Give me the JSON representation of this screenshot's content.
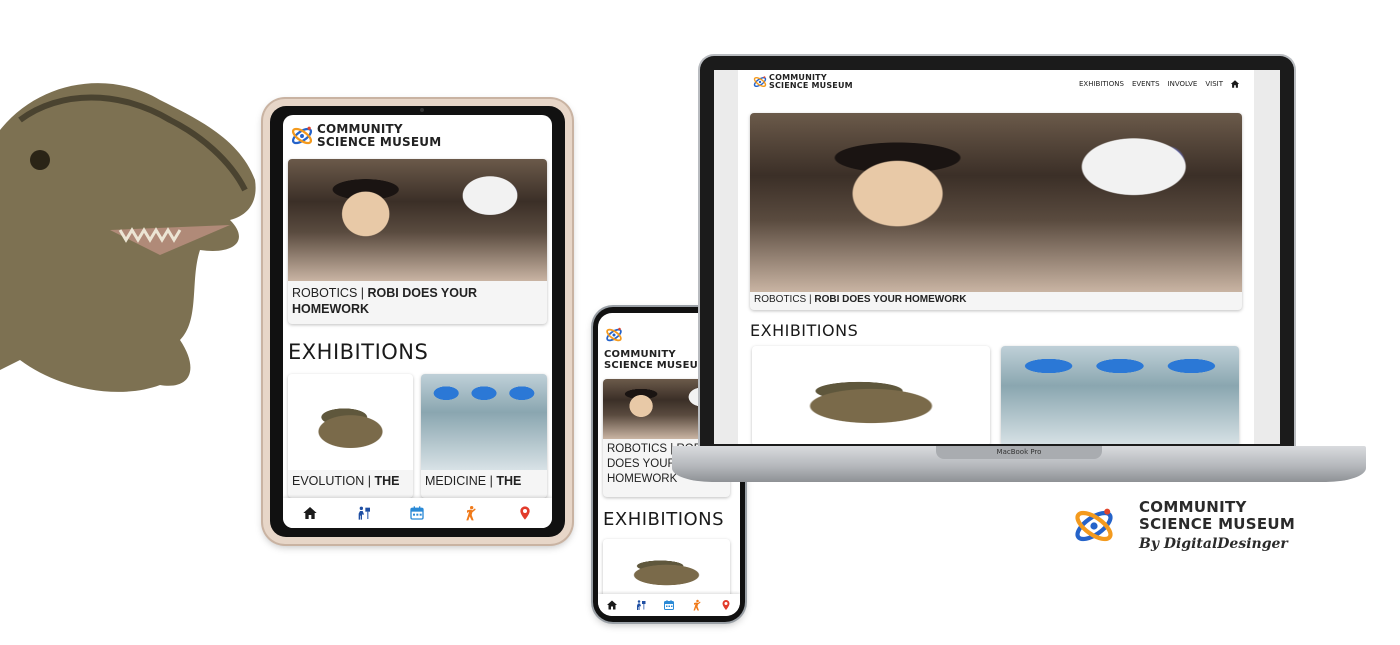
{
  "brand": {
    "name_line1": "COMMUNITY",
    "name_line2": "SCIENCE MUSEUM",
    "byline": "By DigitalDesinger",
    "colors": {
      "blue": "#2563c9",
      "orange": "#f39a1e",
      "red": "#e2452b"
    }
  },
  "feature": {
    "category": "ROBOTICS",
    "separator": "|",
    "title": "ROBI DOES YOUR HOMEWORK"
  },
  "section": {
    "heading": "EXHIBITIONS"
  },
  "exhibitions": [
    {
      "category": "EVOLUTION",
      "separator": "|",
      "title": "THE"
    },
    {
      "category": "MEDICINE",
      "separator": "|",
      "title": "THE"
    }
  ],
  "laptop": {
    "nav": [
      "EXHIBITIONS",
      "EVENTS",
      "INVOLVE",
      "VISIT"
    ],
    "model_label": "MacBook Pro"
  },
  "bottom_nav": {
    "icons": [
      "home-icon",
      "exhibitions-icon",
      "calendar-icon",
      "involve-icon",
      "location-icon"
    ],
    "colors": [
      "#1a1a1a",
      "#1f4fa3",
      "#2b8ad6",
      "#f07a1a",
      "#e23b2b"
    ]
  },
  "tablet_phone_tablet_title_lines": {}
}
